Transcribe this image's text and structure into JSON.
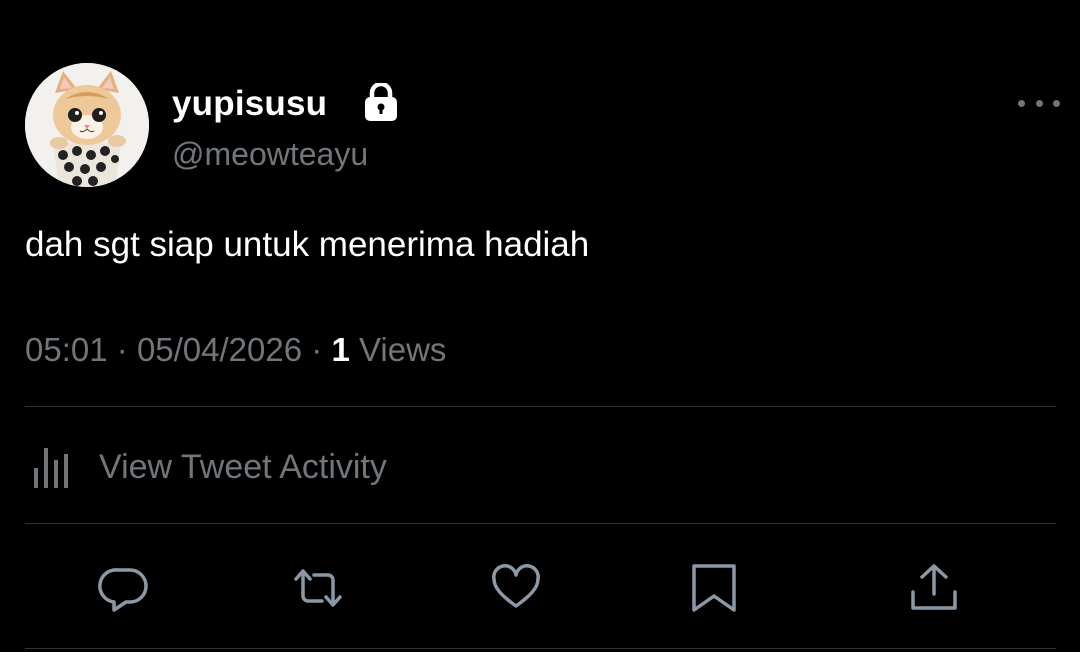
{
  "tweet": {
    "display_name": "yupisusu",
    "handle": "@meowteayu",
    "protected_icon": "lock-icon",
    "text": "dah sgt siap untuk menerima hadiah",
    "time": "05:01",
    "date": "05/04/2026",
    "separator": "·",
    "view_count": "1",
    "view_label": "Views",
    "activity_label": "View Tweet Activity"
  },
  "icons": {
    "more": "more-horizontal-icon",
    "activity": "bar-chart-icon",
    "reply": "reply-icon",
    "retweet": "retweet-icon",
    "like": "heart-icon",
    "bookmark": "bookmark-icon",
    "share": "share-icon"
  },
  "colors": {
    "background": "#000000",
    "primary_text": "#ffffff",
    "secondary_text": "#71767b",
    "divider": "#2f3336"
  }
}
